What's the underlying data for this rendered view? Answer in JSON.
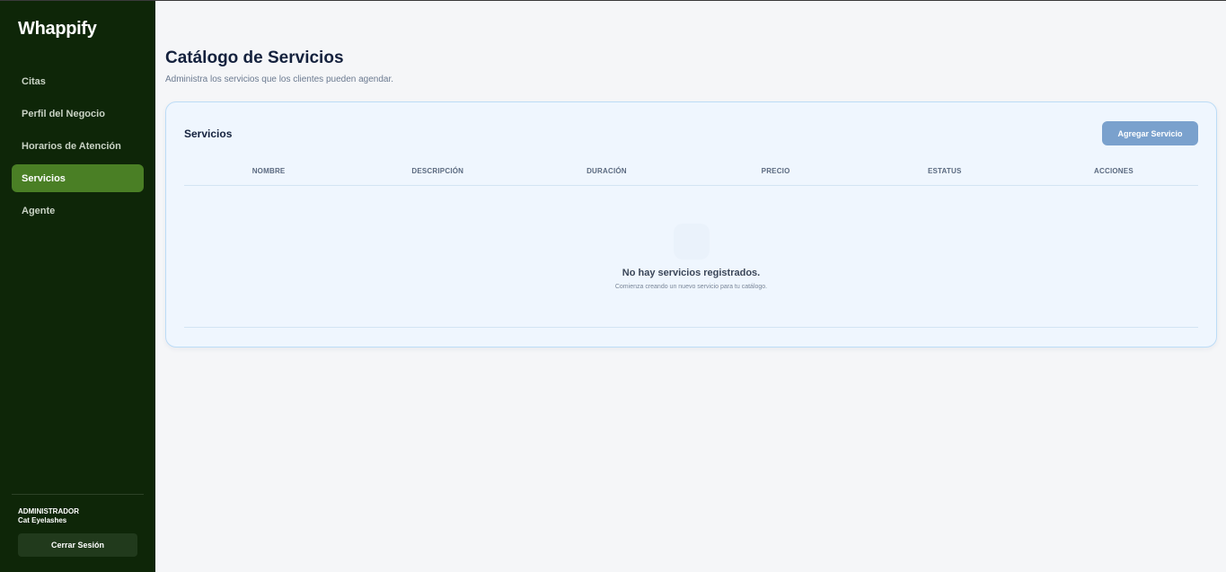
{
  "app": {
    "logo": "Whappify"
  },
  "sidebar": {
    "items": [
      {
        "label": "Citas",
        "active": false
      },
      {
        "label": "Perfil del Negocio",
        "active": false
      },
      {
        "label": "Horarios de Atención",
        "active": false
      },
      {
        "label": "Servicios",
        "active": true
      },
      {
        "label": "Agente",
        "active": false
      }
    ],
    "user_role": "ADMINISTRADOR",
    "user_name": "Cat Eyelashes",
    "logout_label": "Cerrar Sesión"
  },
  "page": {
    "title": "Catálogo de Servicios",
    "subtitle": "Administra los servicios que los clientes pueden agendar."
  },
  "card": {
    "title": "Servicios",
    "add_label": "Agregar Servicio",
    "columns": [
      "NOMBRE",
      "DESCRIPCIÓN",
      "DURACIÓN",
      "PRECIO",
      "ESTATUS",
      "ACCIONES"
    ],
    "empty_title": "No hay servicios registrados.",
    "empty_subtitle": "Comienza creando un nuevo servicio para tu catálogo."
  },
  "colors": {
    "sidebar_bg": "#0e2608",
    "active_item": "#4a7f25",
    "accent_button": "#7aa1cd"
  }
}
